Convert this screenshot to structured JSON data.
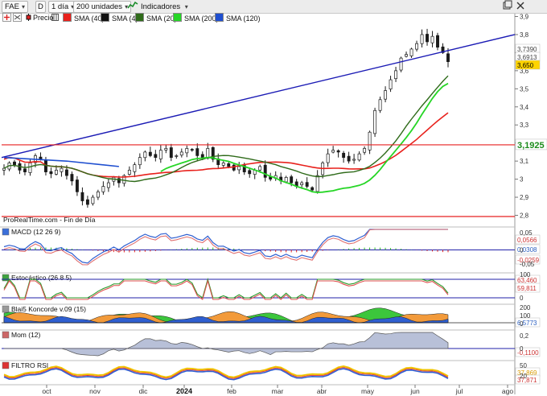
{
  "toolbar": {
    "ticker": "FAE",
    "period_icon": "D",
    "timeframe": "1 día",
    "units": "200 unidades",
    "indicators": "Indicadores"
  },
  "legend": {
    "price": "Precio",
    "sma40": "SMA (40)",
    "sma4": "SMA (4)",
    "sma20": "SMA (20)",
    "sma200": "SMA (200)",
    "sma120": "SMA (120)"
  },
  "panels": {
    "source": "ProRealTime.com - Fin de Día",
    "macd": "MACD (12 26 9)",
    "stoch": "Estocástico (26 8 5)",
    "blai5": "Blai5 Koncorde v.09 (15)",
    "mom": "Mom (12)",
    "filtro": "FILTRO RSI"
  },
  "chart_data": {
    "type": "candlestick",
    "symbol": "FAE",
    "x_labels": [
      "oct",
      "nov",
      "dic",
      "2024",
      "feb",
      "mar",
      "abr",
      "may",
      "jun",
      "jul",
      "ago"
    ],
    "price_axis": [
      "3,9",
      "3,8",
      "3,7",
      "3,6",
      "3,5",
      "3,4",
      "3,3",
      "3,2",
      "3,1",
      "3",
      "2,9",
      "2,8"
    ],
    "price_ylim": [
      2.78,
      3.92
    ],
    "close_series": [
      3.06,
      3.09,
      3.08,
      3.05,
      3.04,
      3.09,
      3.13,
      3.11,
      3.04,
      3.03,
      3.05,
      3.06,
      3.02,
      2.99,
      2.93,
      2.88,
      2.86,
      2.9,
      2.93,
      2.96,
      2.98,
      3.01,
      2.98,
      3.02,
      3.05,
      3.08,
      3.12,
      3.15,
      3.13,
      3.12,
      3.16,
      3.17,
      3.12,
      3.13,
      3.15,
      3.17,
      3.16,
      3.13,
      3.12,
      3.17,
      3.11,
      3.08,
      3.09,
      3.07,
      3.05,
      3.07,
      3.04,
      3.03,
      3.05,
      3.07,
      3.01,
      3.0,
      3.02,
      2.99,
      3.01,
      2.98,
      2.96,
      2.98,
      2.96,
      2.94,
      3.02,
      3.09,
      3.14,
      3.16,
      3.15,
      3.12,
      3.1,
      3.11,
      3.14,
      3.17,
      3.26,
      3.38,
      3.44,
      3.49,
      3.55,
      3.6,
      3.67,
      3.69,
      3.72,
      3.75,
      3.8,
      3.76,
      3.79,
      3.73,
      3.7,
      3.65
    ],
    "price_labels": {
      "sma40": "3,7390",
      "sma4": "3,6913",
      "last": "3,650",
      "sma200": "3,1925"
    },
    "trendline_start_value": 3.12,
    "trendline_end_value": 3.8,
    "support_level": 3.19,
    "macd_labels": [
      "0,0566",
      "0,0308",
      "-0,0259"
    ],
    "macd_axis": [
      "0,05",
      "0",
      "-0,05"
    ],
    "stoch_labels": [
      "63,460",
      "59,811"
    ],
    "stoch_axis": [
      "100",
      "0"
    ],
    "blai5_label": "6,5773",
    "blai5_axis": [
      "200",
      "100",
      "0"
    ],
    "mom_label": "-0,1100",
    "mom_axis": [
      "0,2",
      "0",
      "-0,2"
    ],
    "filtro_labels": [
      "37,869",
      "37,871"
    ],
    "filtro_axis": [
      "50",
      "20"
    ]
  },
  "colors": {
    "bg": "#ffffff",
    "candle": "#1a1a1a",
    "sma40": "#e8211c",
    "sma4": "#111111",
    "sma20": "#2f6b1a",
    "sma200": "#26d626",
    "sma120": "#1f4fd0",
    "trendline": "#1b1bb5",
    "support": "#e82222",
    "last_badge": "#ffd400",
    "label_sma200": "#1c8c1c"
  }
}
